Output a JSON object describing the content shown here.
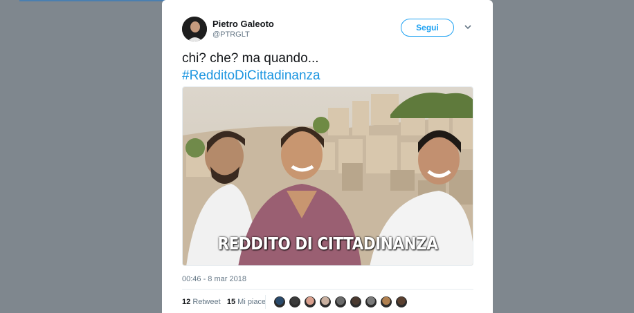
{
  "tweet": {
    "author_name": "Pietro Galeoto",
    "author_handle": "@PTRGLT",
    "follow_label": "Segui",
    "text_line1": "chi? che? ma quando...",
    "hashtag": "#RedditoDiCittadinanza",
    "image_caption": "REDDITO DI CITTADINANZA",
    "timestamp": "00:46 - 8 mar 2018",
    "retweet_count": "12",
    "retweet_label": "Retweet",
    "like_count": "15",
    "like_label": "Mi piace",
    "liker_avatars": [
      "#2a4a6b",
      "#3a3a3a",
      "#d9a08e",
      "#c9b0a0",
      "#6a6a6a",
      "#4a3a30",
      "#7a7a7a",
      "#b08050",
      "#5a4030"
    ]
  },
  "colors": {
    "backdrop": "#7f878e",
    "accent": "#1da1f2",
    "hashtag": "#1b95e0"
  }
}
